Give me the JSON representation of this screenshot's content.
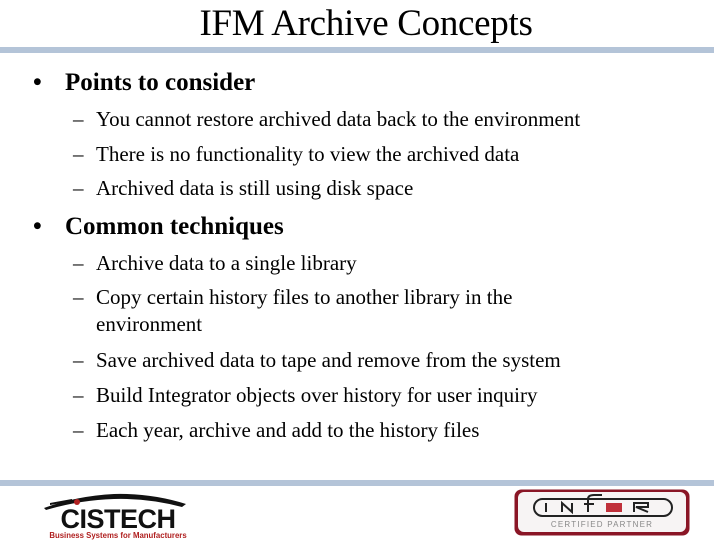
{
  "slide": {
    "title": "IFM Archive Concepts",
    "sections": [
      {
        "heading": "Points to consider",
        "items": [
          "You cannot restore archived data back to the environment",
          "There is no functionality to view the archived data",
          "Archived data is still using disk space"
        ]
      },
      {
        "heading": "Common techniques",
        "items": [
          "Archive data to a single library",
          "Copy certain history files to another library in the environment",
          "Save archived data to tape and remove from the system",
          "Build Integrator objects over history for user inquiry",
          "Each year, archive and add to the history files"
        ]
      }
    ],
    "bullet_glyph": "•",
    "dash_glyph": "–"
  },
  "footer": {
    "left_logo": {
      "name": "CISTECH",
      "tagline": "Business Systems for Manufacturers"
    },
    "right_logo": {
      "name": "INFOR",
      "subtitle": "CERTIFIED PARTNER"
    }
  },
  "colors": {
    "rule": "#b4c4d8",
    "cistech_red": "#b02020",
    "infor_red": "#a01830"
  }
}
